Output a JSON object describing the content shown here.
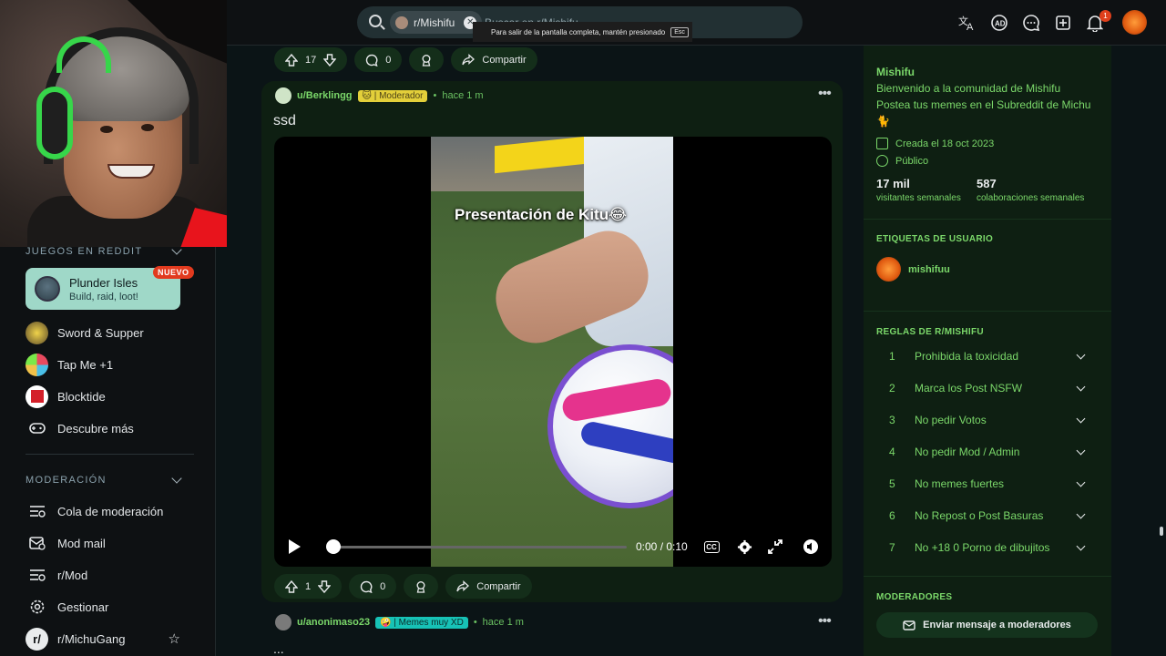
{
  "sidebar": {
    "games_section": "JUEGOS EN REDDIT",
    "featured_game": {
      "name": "Plunder Isles",
      "subtitle": "Build, raid, loot!",
      "badge": "NUEVO"
    },
    "games": [
      {
        "label": "Sword & Supper",
        "icon": "sword-game-icon"
      },
      {
        "label": "Tap Me +1",
        "icon": "tapme-game-icon"
      },
      {
        "label": "Blocktide",
        "icon": "blocktide-game-icon"
      },
      {
        "label": "Descubre más",
        "icon": "gamepad-icon"
      }
    ],
    "mod_section": "MODERACIÓN",
    "mod_items": [
      {
        "label": "Cola de moderación",
        "icon": "queue-icon"
      },
      {
        "label": "Mod mail",
        "icon": "mail-icon"
      },
      {
        "label": "r/Mod",
        "icon": "queue-icon"
      },
      {
        "label": "Gestionar",
        "icon": "gear-icon"
      },
      {
        "label": "r/MichuGang",
        "icon": "community-icon"
      }
    ]
  },
  "topbar": {
    "search_chip": "r/Mishifu",
    "search_placeholder": "Buscar en r/Mishifu",
    "fullscreen_toast": "Para salir de la pantalla completa, mantén presionado",
    "toast_key": "Esc",
    "notification_count": "1"
  },
  "prev_post_actions": {
    "votes": "17",
    "comments": "0",
    "share": "Compartir"
  },
  "post": {
    "author": "u/Berklingg",
    "flair": "🐱 | Moderador",
    "time": "hace 1 m",
    "title": "ssd",
    "video": {
      "caption": "Presentación de Kitu😂",
      "time": "0:00 / 0:10",
      "progress": 0.0
    },
    "actions": {
      "votes": "1",
      "comments": "0",
      "share": "Compartir"
    }
  },
  "next_post": {
    "author": "u/anonimaso23",
    "flair": "🤪 | Memes muy XD",
    "time": "hace 1 m",
    "title": "..."
  },
  "community": {
    "name": "Mishifu",
    "desc1": "Bienvenido a la comunidad de Mishifu",
    "desc2": "Postea tus memes en el Subreddit de Michu",
    "desc3": "🐈",
    "created": "Creada el 18 oct 2023",
    "visibility": "Público",
    "visitors": "17 mil",
    "visitors_label": "visitantes semanales",
    "contributions": "587",
    "contributions_label": "colaboraciones semanales",
    "user_tags_head": "ETIQUETAS DE USUARIO",
    "user_tag": "mishifuu",
    "rules_head": "REGLAS DE R/MISHIFU",
    "rules": [
      {
        "n": "1",
        "t": "Prohibida la toxicidad"
      },
      {
        "n": "2",
        "t": "Marca los Post NSFW"
      },
      {
        "n": "3",
        "t": "No pedir Votos"
      },
      {
        "n": "4",
        "t": "No pedir Mod / Admin"
      },
      {
        "n": "5",
        "t": "No memes fuertes"
      },
      {
        "n": "6",
        "t": "No Repost o Post Basuras"
      },
      {
        "n": "7",
        "t": "No +18 0 Porno de dibujitos"
      }
    ],
    "mods_head": "MODERADORES",
    "mod_message_button": "Enviar mensaje a moderadores"
  },
  "colors": {
    "accent_green": "#7bd86a",
    "post_bg": "#0e1f12",
    "page_bg": "#0b1416"
  }
}
